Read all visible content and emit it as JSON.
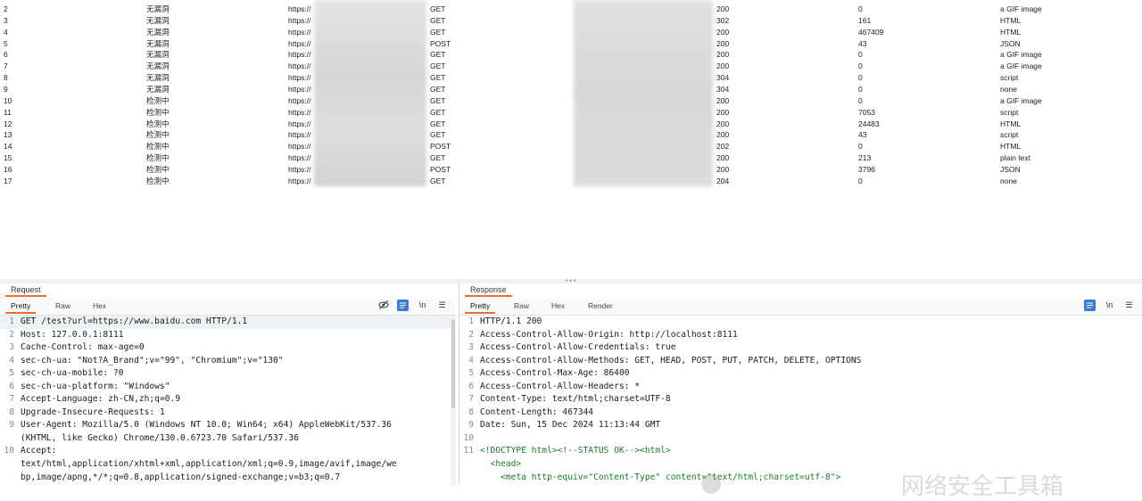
{
  "history": {
    "rows": [
      {
        "num": "2",
        "scan": "无漏洞",
        "host": "https://",
        "method": "GET",
        "status": "200",
        "length": "0",
        "mime": "a GIF image"
      },
      {
        "num": "3",
        "scan": "无漏洞",
        "host": "https://",
        "method": "GET",
        "status": "302",
        "length": "161",
        "mime": "HTML"
      },
      {
        "num": "4",
        "scan": "无漏洞",
        "host": "https://",
        "method": "GET",
        "status": "200",
        "length": "467409",
        "mime": "HTML"
      },
      {
        "num": "5",
        "scan": "无漏洞",
        "host": "https://",
        "method": "POST",
        "status": "200",
        "length": "43",
        "mime": "JSON"
      },
      {
        "num": "6",
        "scan": "无漏洞",
        "host": "https://",
        "method": "GET",
        "status": "200",
        "length": "0",
        "mime": "a GIF image"
      },
      {
        "num": "7",
        "scan": "无漏洞",
        "host": "https://",
        "method": "GET",
        "status": "200",
        "length": "0",
        "mime": "a GIF image"
      },
      {
        "num": "8",
        "scan": "无漏洞",
        "host": "https://",
        "method": "GET",
        "status": "304",
        "length": "0",
        "mime": "script"
      },
      {
        "num": "9",
        "scan": "无漏洞",
        "host": "https://",
        "method": "GET",
        "status": "304",
        "length": "0",
        "mime": "none"
      },
      {
        "num": "10",
        "scan": "检测中",
        "host": "https://",
        "method": "GET",
        "status": "200",
        "length": "0",
        "mime": "a GIF image"
      },
      {
        "num": "11",
        "scan": "检测中",
        "host": "https://",
        "method": "GET",
        "status": "200",
        "length": "7053",
        "mime": "script"
      },
      {
        "num": "12",
        "scan": "检测中",
        "host": "https://",
        "method": "GET",
        "status": "200",
        "length": "24483",
        "mime": "HTML"
      },
      {
        "num": "13",
        "scan": "检测中",
        "host": "https://",
        "method": "GET",
        "status": "200",
        "length": "43",
        "mime": "script"
      },
      {
        "num": "14",
        "scan": "检测中",
        "host": "https://",
        "method": "POST",
        "status": "202",
        "length": "0",
        "mime": "HTML"
      },
      {
        "num": "15",
        "scan": "检测中",
        "host": "https://",
        "method": "GET",
        "status": "200",
        "length": "213",
        "mime": "plain text"
      },
      {
        "num": "16",
        "scan": "检测中",
        "host": "https://",
        "method": "POST",
        "status": "200",
        "length": "3796",
        "mime": "JSON"
      },
      {
        "num": "17",
        "scan": "检测中",
        "host": "https://",
        "method": "GET",
        "status": "204",
        "length": "0",
        "mime": "none"
      }
    ]
  },
  "request": {
    "title": "Request",
    "tabs": [
      "Pretty",
      "Raw",
      "Hex"
    ],
    "toolbar": {
      "hide_icon": "eye-off-icon",
      "wrap_icon": "wrap-lines-icon",
      "newline_label": "\\n",
      "menu_icon": "menu-icon"
    },
    "lines": [
      {
        "n": "1",
        "t": "GET /test?url=https://www.baidu.com HTTP/1.1"
      },
      {
        "n": "2",
        "t": "Host: 127.0.0.1:8111"
      },
      {
        "n": "3",
        "t": "Cache-Control: max-age=0"
      },
      {
        "n": "4",
        "t": "sec-ch-ua: \"Not?A_Brand\";v=\"99\", \"Chromium\";v=\"130\""
      },
      {
        "n": "5",
        "t": "sec-ch-ua-mobile: ?0"
      },
      {
        "n": "6",
        "t": "sec-ch-ua-platform: \"Windows\""
      },
      {
        "n": "7",
        "t": "Accept-Language: zh-CN,zh;q=0.9"
      },
      {
        "n": "8",
        "t": "Upgrade-Insecure-Requests: 1"
      },
      {
        "n": "9",
        "t": "User-Agent: Mozilla/5.0 (Windows NT 10.0; Win64; x64) AppleWebKit/537.36"
      },
      {
        "n": "",
        "t": "(KHTML, like Gecko) Chrome/130.0.6723.70 Safari/537.36"
      },
      {
        "n": "10",
        "t": "Accept:"
      },
      {
        "n": "",
        "t": "text/html,application/xhtml+xml,application/xml;q=0.9,image/avif,image/we"
      },
      {
        "n": "",
        "t": "bp,image/apng,*/*;q=0.8,application/signed-exchange;v=b3;q=0.7"
      }
    ]
  },
  "response": {
    "title": "Response",
    "tabs": [
      "Pretty",
      "Raw",
      "Hex",
      "Render"
    ],
    "toolbar": {
      "wrap_icon": "wrap-lines-icon",
      "newline_label": "\\n",
      "menu_icon": "menu-icon"
    },
    "lines": [
      {
        "n": "1",
        "t": "HTTP/1.1 200"
      },
      {
        "n": "2",
        "t": "Access-Control-Allow-Origin: http://localhost:8111"
      },
      {
        "n": "3",
        "t": "Access-Control-Allow-Credentials: true"
      },
      {
        "n": "4",
        "t": "Access-Control-Allow-Methods: GET, HEAD, POST, PUT, PATCH, DELETE, OPTIONS"
      },
      {
        "n": "5",
        "t": "Access-Control-Max-Age: 86400"
      },
      {
        "n": "6",
        "t": "Access-Control-Allow-Headers: *"
      },
      {
        "n": "7",
        "t": "Content-Type: text/html;charset=UTF-8"
      },
      {
        "n": "8",
        "t": "Content-Length: 467344"
      },
      {
        "n": "9",
        "t": "Date: Sun, 15 Dec 2024 11:13:44 GMT"
      },
      {
        "n": "10",
        "t": ""
      },
      {
        "n": "11",
        "t": "<!DOCTYPE html><!--STATUS OK--><html>"
      },
      {
        "n": "",
        "t": "  <head>"
      },
      {
        "n": "",
        "t": "    <meta http-equiv=\"Content-Type\" content=\"text/html;charset=utf-8\">"
      }
    ]
  },
  "watermark": {
    "text": "网络安全工具箱"
  },
  "colors": {
    "accent": "#e8702a",
    "button_blue": "#3b7bd8"
  }
}
